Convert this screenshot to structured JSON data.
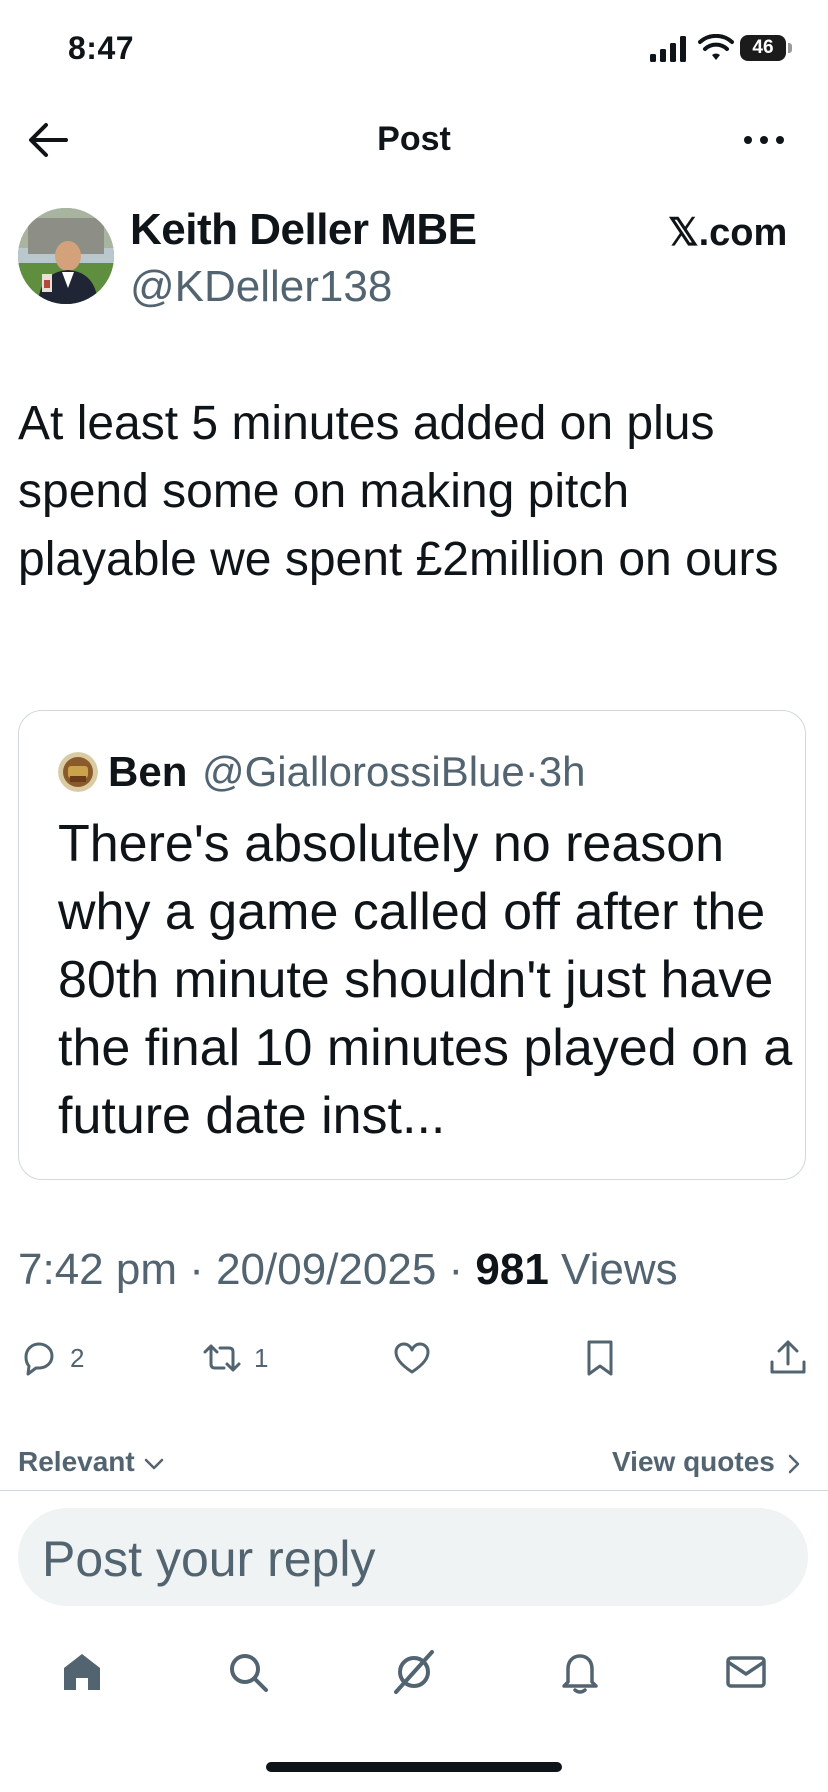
{
  "status_bar": {
    "time": "8:47",
    "battery": "46"
  },
  "nav": {
    "title": "Post"
  },
  "author": {
    "display_name": "Keith Deller MBE",
    "handle": "@KDeller138",
    "source": "𝕏.com"
  },
  "tweet": {
    "text": "At least 5 minutes added on  plus spend some on making pitch playable we spent £2million on ours"
  },
  "quote": {
    "name": "Ben",
    "handle_time": "@GiallorossiBlue·3h",
    "text": "There's absolutely no reason why a game called off after the 80th minute shouldn't just have the final 10 minutes played on a future date inst..."
  },
  "meta": {
    "time_date": "7:42 pm · 20/09/2025 · ",
    "views_count": "981",
    "views_label": " Views"
  },
  "actions": {
    "replies": "2",
    "reposts": "1"
  },
  "filters": {
    "sort": "Relevant",
    "view_quotes": "View quotes"
  },
  "reply": {
    "placeholder": "Post your reply"
  },
  "icons": {
    "back": "back-arrow-icon",
    "more": "more-icon",
    "reply": "reply-icon",
    "repost": "repost-icon",
    "like": "heart-icon",
    "bookmark": "bookmark-icon",
    "share": "share-icon",
    "home": "home-icon",
    "search": "search-icon",
    "grok": "grok-icon",
    "notifications": "bell-icon",
    "messages": "mail-icon"
  }
}
